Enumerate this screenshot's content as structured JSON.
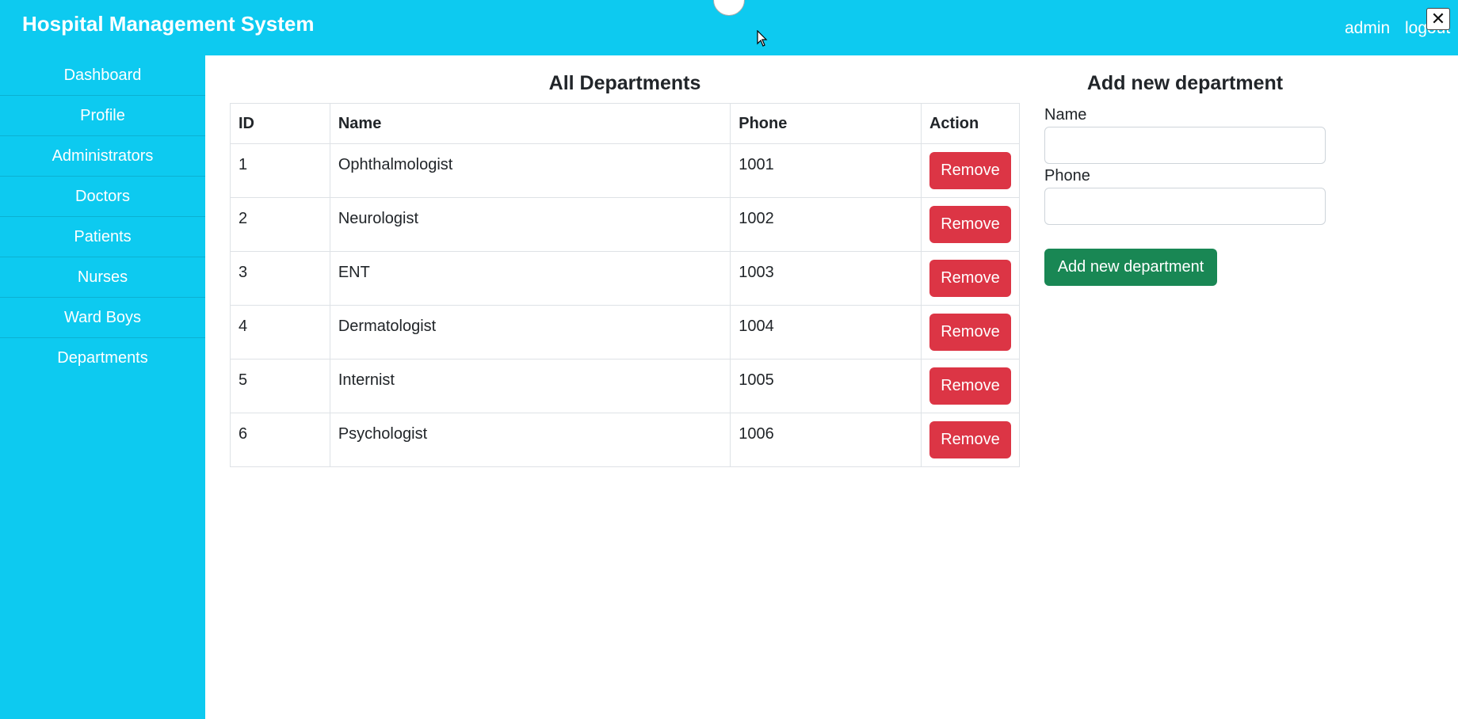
{
  "app": {
    "title": "Hospital Management System"
  },
  "topbar": {
    "user": "admin",
    "logout": "logout",
    "close_glyph": "✕"
  },
  "sidebar": {
    "items": [
      {
        "label": "Dashboard"
      },
      {
        "label": "Profile"
      },
      {
        "label": "Administrators"
      },
      {
        "label": "Doctors"
      },
      {
        "label": "Patients"
      },
      {
        "label": "Nurses"
      },
      {
        "label": "Ward Boys"
      },
      {
        "label": "Departments"
      }
    ]
  },
  "departments": {
    "title": "All Departments",
    "columns": [
      "ID",
      "Name",
      "Phone",
      "Action"
    ],
    "remove_label": "Remove",
    "rows": [
      {
        "id": "1",
        "name": "Ophthalmologist",
        "phone": "1001"
      },
      {
        "id": "2",
        "name": "Neurologist",
        "phone": "1002"
      },
      {
        "id": "3",
        "name": "ENT",
        "phone": "1003"
      },
      {
        "id": "4",
        "name": "Dermatologist",
        "phone": "1004"
      },
      {
        "id": "5",
        "name": "Internist",
        "phone": "1005"
      },
      {
        "id": "6",
        "name": "Psychologist",
        "phone": "1006"
      }
    ]
  },
  "add_form": {
    "title": "Add new department",
    "name_label": "Name",
    "name_value": "",
    "phone_label": "Phone",
    "phone_value": "",
    "submit_label": "Add new department"
  },
  "colors": {
    "primary_bar": "#0dcaf0",
    "danger": "#dc3545",
    "success": "#198754"
  }
}
